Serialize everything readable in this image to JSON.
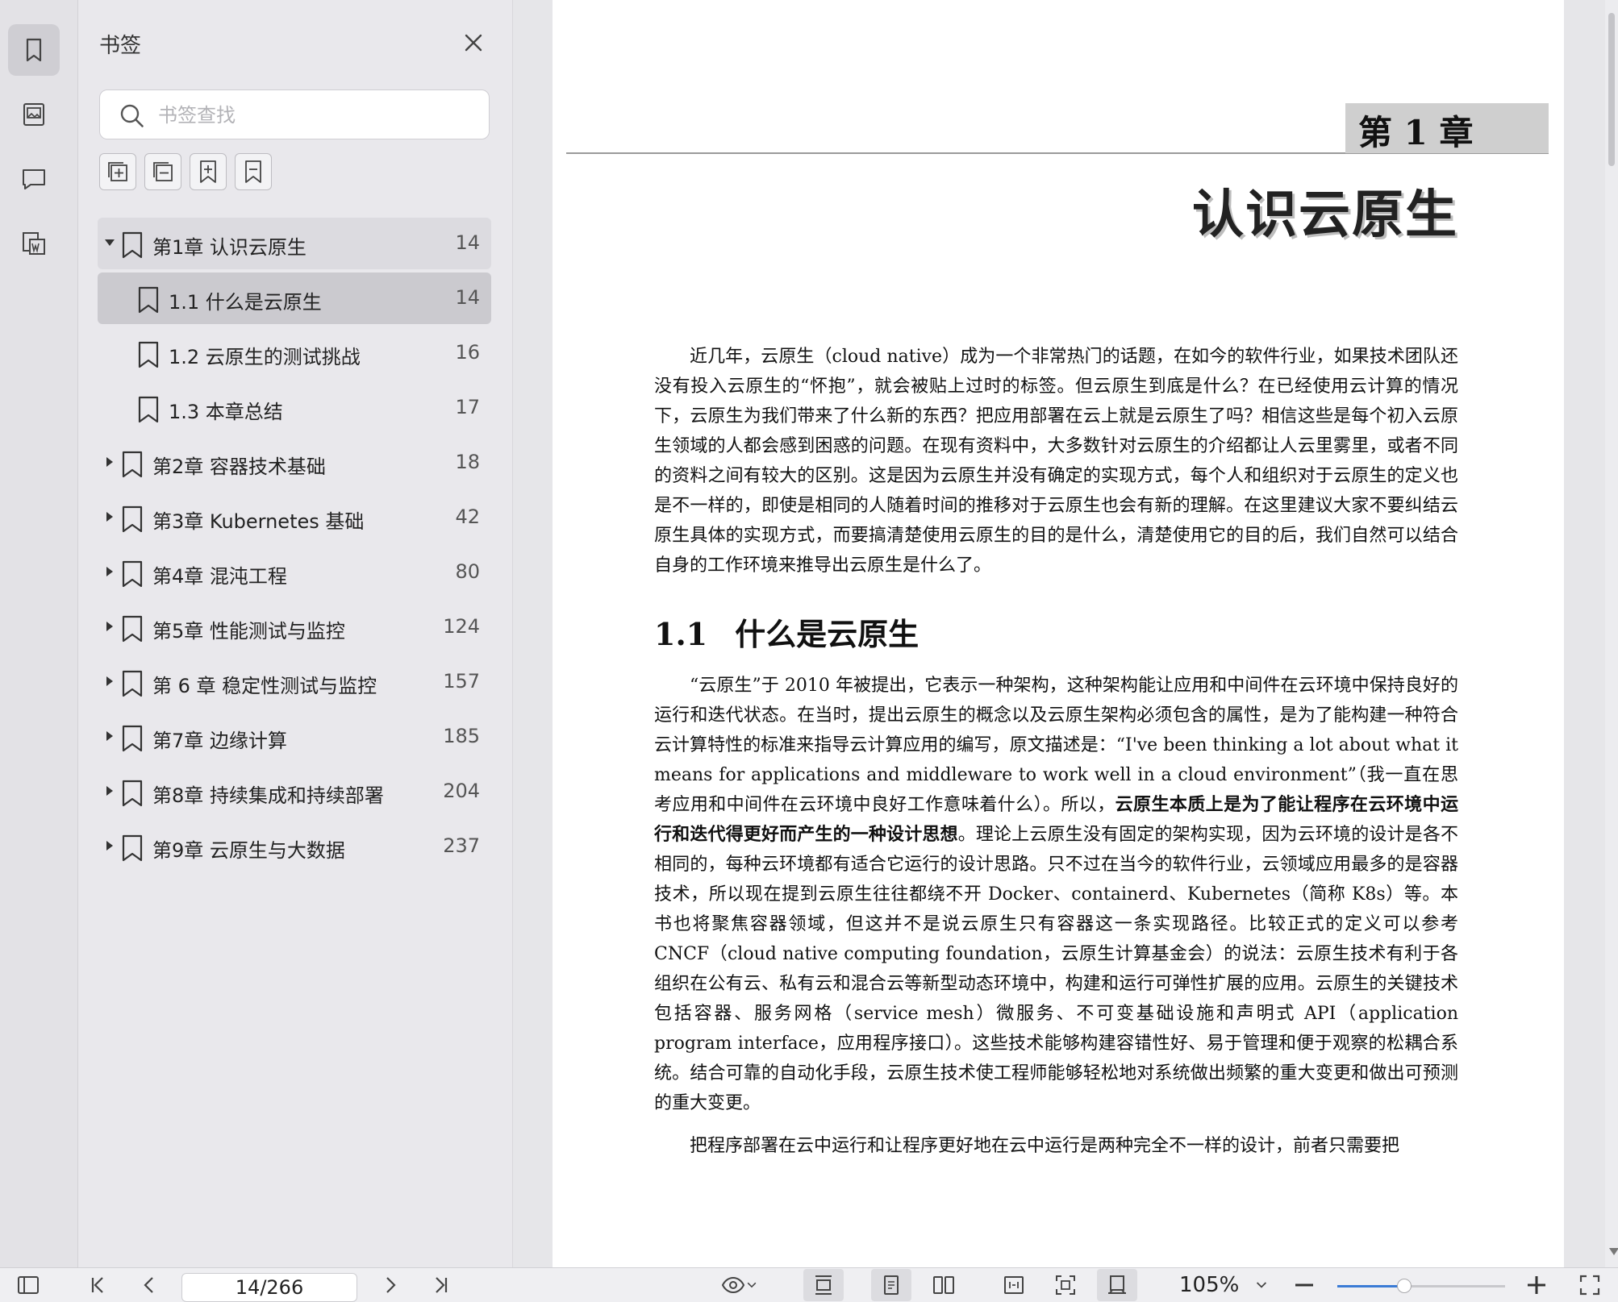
{
  "sidebar": {
    "title": "书签",
    "search_placeholder": "书签查找",
    "bookmarks": [
      {
        "label": "第1章 认识云原生",
        "page": "14",
        "level": 0,
        "expanded": true,
        "state": "parent"
      },
      {
        "label": "1.1 什么是云原生",
        "page": "14",
        "level": 1,
        "state": "selected"
      },
      {
        "label": "1.2 云原生的测试挑战",
        "page": "16",
        "level": 1
      },
      {
        "label": "1.3 本章总结",
        "page": "17",
        "level": 1
      },
      {
        "label": "第2章 容器技术基础",
        "page": "18",
        "level": 0,
        "expanded": false
      },
      {
        "label": "第3章 Kubernetes 基础",
        "page": "42",
        "level": 0,
        "expanded": false
      },
      {
        "label": "第4章 混沌工程",
        "page": "80",
        "level": 0,
        "expanded": false
      },
      {
        "label": "第5章 性能测试与监控",
        "page": "124",
        "level": 0,
        "expanded": false
      },
      {
        "label": "第 6 章 稳定性测试与监控",
        "page": "157",
        "level": 0,
        "expanded": false
      },
      {
        "label": "第7章 边缘计算",
        "page": "185",
        "level": 0,
        "expanded": false
      },
      {
        "label": "第8章 持续集成和持续部署",
        "page": "204",
        "level": 0,
        "expanded": false
      },
      {
        "label": "第9章 云原生与大数据",
        "page": "237",
        "level": 0,
        "expanded": false
      }
    ]
  },
  "document": {
    "chapter_label": "第 1 章",
    "chapter_title": "认识云原生",
    "intro_paragraph": "近几年，云原生（cloud native）成为一个非常热门的话题，在如今的软件行业，如果技术团队还没有投入云原生的“怀抱”，就会被贴上过时的标签。但云原生到底是什么？在已经使用云计算的情况下，云原生为我们带来了什么新的东西？把应用部署在云上就是云原生了吗？相信这些是每个初入云原生领域的人都会感到困惑的问题。在现有资料中，大多数针对云原生的介绍都让人云里雾里，或者不同的资料之间有较大的区别。这是因为云原生并没有确定的实现方式，每个人和组织对于云原生的定义也是不一样的，即使是相同的人随着时间的推移对于云原生也会有新的理解。在这里建议大家不要纠结云原生具体的实现方式，而要搞清楚使用云原生的目的是什么，清楚使用它的目的后，我们自然可以结合自身的工作环境来推导出云原生是什么了。",
    "section_number": "1.1",
    "section_title": "什么是云原生",
    "p2_part1": "“云原生”于 2010 年被提出，它表示一种架构，这种架构能让应用和中间件在云环境中保持良好的运行和迭代状态。在当时，提出云原生的概念以及云原生架构必须包含的属性，是为了能构建一种符合云计算特性的标准来指导云计算应用的编写，原文描述是：“I've been thinking a lot about what it means for applications and middleware to work well in a cloud environment”（我一直在思考应用和中间件在云环境中良好工作意味着什么）。所以，",
    "p2_bold": "云原生本质上是为了能让程序在云环境中运行和迭代得更好而产生的一种设计思想",
    "p2_part2": "。理论上云原生没有固定的架构实现，因为云环境的设计是各不相同的，每种云环境都有适合它运行的设计思路。只不过在当今的软件行业，云领域应用最多的是容器技术，所以现在提到云原生往往都绕不开 Docker、containerd、Kubernetes（简称 K8s）等。本书也将聚焦容器领域，但这并不是说云原生只有容器这一条实现路径。比较正式的定义可以参考 CNCF（cloud native computing foundation，云原生计算基金会）的说法：云原生技术有利于各组织在公有云、私有云和混合云等新型动态环境中，构建和运行可弹性扩展的应用。云原生的关键技术包括容器、服务网格（service mesh）微服务、不可变基础设施和声明式 API（application program interface，应用程序接口）。这些技术能够构建容错性好、易于管理和便于观察的松耦合系统。结合可靠的自动化手段，云原生技术使工程师能够轻松地对系统做出频繁的重大变更和做出可预测的重大变更。",
    "p3": "把程序部署在云中运行和让程序更好地在云中运行是两种完全不一样的设计，前者只需要把"
  },
  "toolbar": {
    "page_indicator": "14/266",
    "zoom": "105%",
    "zoom_slider_fraction": 0.4,
    "accent_color": "#3a7bd5"
  }
}
